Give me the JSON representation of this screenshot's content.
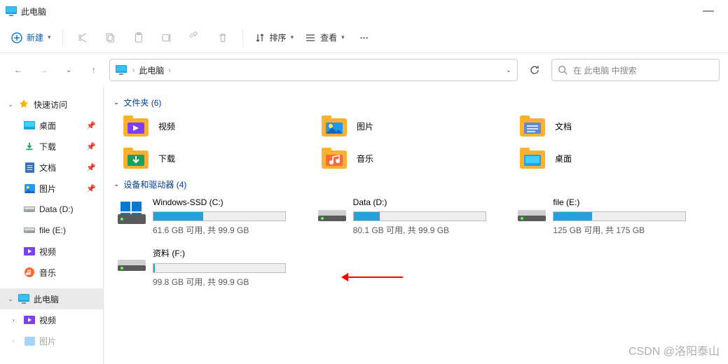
{
  "title": "此电脑",
  "toolbar": {
    "new_label": "新建",
    "sort_label": "排序",
    "view_label": "查看"
  },
  "breadcrumb": {
    "root": "此电脑"
  },
  "search": {
    "placeholder": "在 此电脑 中搜索"
  },
  "sidebar": {
    "quick": "快速访问",
    "items": [
      {
        "label": "桌面",
        "pin": true
      },
      {
        "label": "下载",
        "pin": true
      },
      {
        "label": "文档",
        "pin": true
      },
      {
        "label": "图片",
        "pin": true
      },
      {
        "label": "Data (D:)",
        "pin": false
      },
      {
        "label": "file (E:)",
        "pin": false
      },
      {
        "label": "视频",
        "pin": false
      },
      {
        "label": "音乐",
        "pin": false
      }
    ],
    "pc": "此电脑",
    "pc_children": [
      "视频",
      "图片"
    ]
  },
  "sections": {
    "folders": "文件夹 (6)",
    "devices": "设备和驱动器 (4)"
  },
  "folders": [
    {
      "label": "视频"
    },
    {
      "label": "图片"
    },
    {
      "label": "文档"
    },
    {
      "label": "下载"
    },
    {
      "label": "音乐"
    },
    {
      "label": "桌面"
    }
  ],
  "drives": [
    {
      "name": "Windows-SSD (C:)",
      "free": "61.6 GB 可用, 共 99.9 GB",
      "pct": 38
    },
    {
      "name": "Data (D:)",
      "free": "80.1 GB 可用, 共 99.9 GB",
      "pct": 20
    },
    {
      "name": "file (E:)",
      "free": "125 GB 可用, 共 175 GB",
      "pct": 29
    },
    {
      "name": "资料 (F:)",
      "free": "99.8 GB 可用, 共 99.9 GB",
      "pct": 1
    }
  ],
  "watermark": "CSDN @洛阳泰山"
}
